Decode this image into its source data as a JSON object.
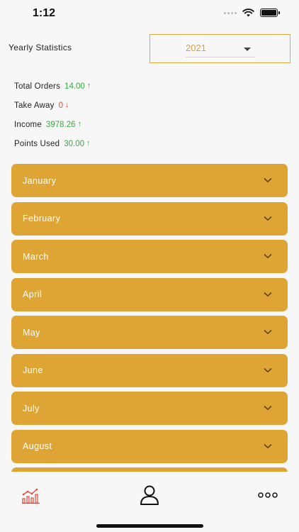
{
  "status_bar": {
    "time": "1:12"
  },
  "header": {
    "yearly_label": "Yearly Statistics",
    "selected_year": "2021"
  },
  "stats": [
    {
      "label": "Total Orders",
      "value": "14.00",
      "trend": "up"
    },
    {
      "label": "Take Away",
      "value": "0",
      "trend": "down"
    },
    {
      "label": "Income",
      "value": "3978.26",
      "trend": "up"
    },
    {
      "label": "Points Used",
      "value": "30.00",
      "trend": "up"
    }
  ],
  "months": [
    "January",
    "February",
    "March",
    "April",
    "May",
    "June",
    "July",
    "August",
    ""
  ],
  "colors": {
    "accent": "#dea534",
    "up": "#3aa843",
    "down": "#e04a3a",
    "nav_active": "#e04a3a"
  },
  "icons": {
    "status": [
      "signal-icon",
      "wifi-icon",
      "battery-icon"
    ],
    "nav": [
      "stats-chart-icon",
      "profile-icon",
      "more-icon"
    ]
  }
}
